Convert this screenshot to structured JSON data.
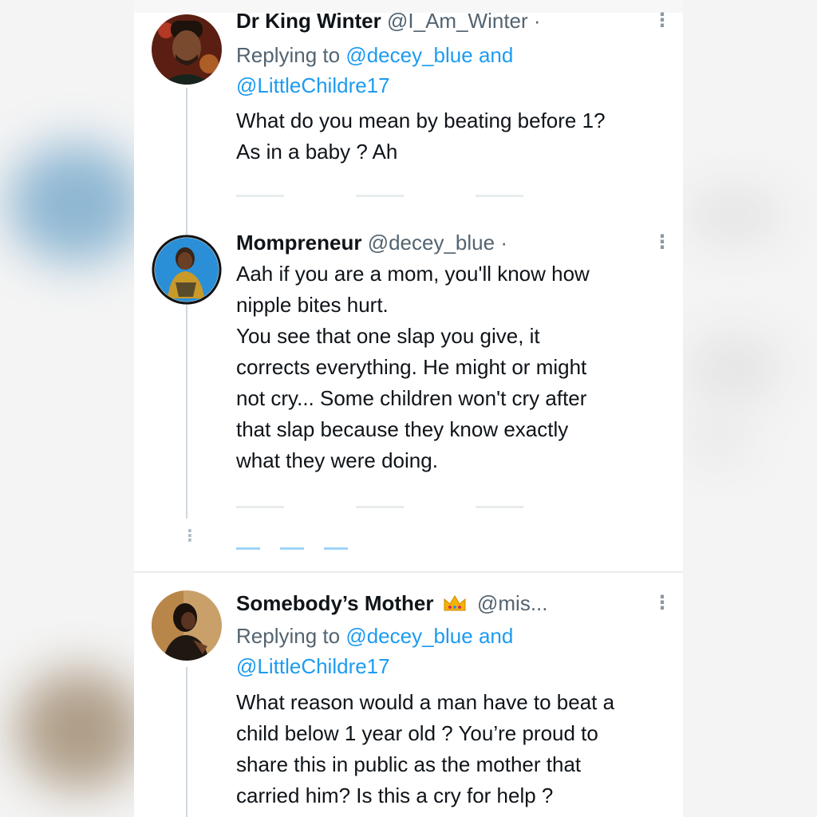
{
  "colors": {
    "text": "#0f1419",
    "secondary": "#536471",
    "link": "#1d9bf0",
    "separator": "#e9ecef"
  },
  "tweets": [
    {
      "name": "Dr King Winter",
      "handle": "@I_Am_Winter",
      "separator": "·",
      "avatar_icon": "user-avatar-man",
      "reply_prefix": "Replying to",
      "reply_mention_1": "@decey_blue",
      "reply_and": "and",
      "reply_mention_2": "@LittleChildre17",
      "text_lines": [
        "What do you mean by beating before 1?",
        "As in a baby ? Ah"
      ],
      "more_icon": "more-options-icon"
    },
    {
      "name": "Mompreneur",
      "handle": "@decey_blue",
      "separator": "·",
      "avatar_icon": "user-avatar-woman",
      "text_lines": [
        "Aah if you are a mom, you'll know how",
        "nipple bites hurt.",
        "You see that one slap you give, it",
        "corrects everything. He might or might",
        "not cry... Some children won't cry after",
        "that slap because they know exactly",
        "what they were doing."
      ],
      "more_icon": "more-options-icon"
    },
    {
      "name": "Somebody’s Mother",
      "badge": "crown-emoji",
      "handle": "@mis...",
      "avatar_icon": "user-avatar-woman",
      "reply_prefix": "Replying to",
      "reply_mention_1": "@decey_blue",
      "reply_and": "and",
      "reply_mention_2": "@LittleChildre17",
      "text_lines": [
        "What reason would a man have to beat a",
        "child below 1 year old ? You’re proud to",
        "share this in public as the mother that",
        "carried him? Is this a cry for help ?"
      ],
      "more_icon": "more-options-icon"
    }
  ]
}
